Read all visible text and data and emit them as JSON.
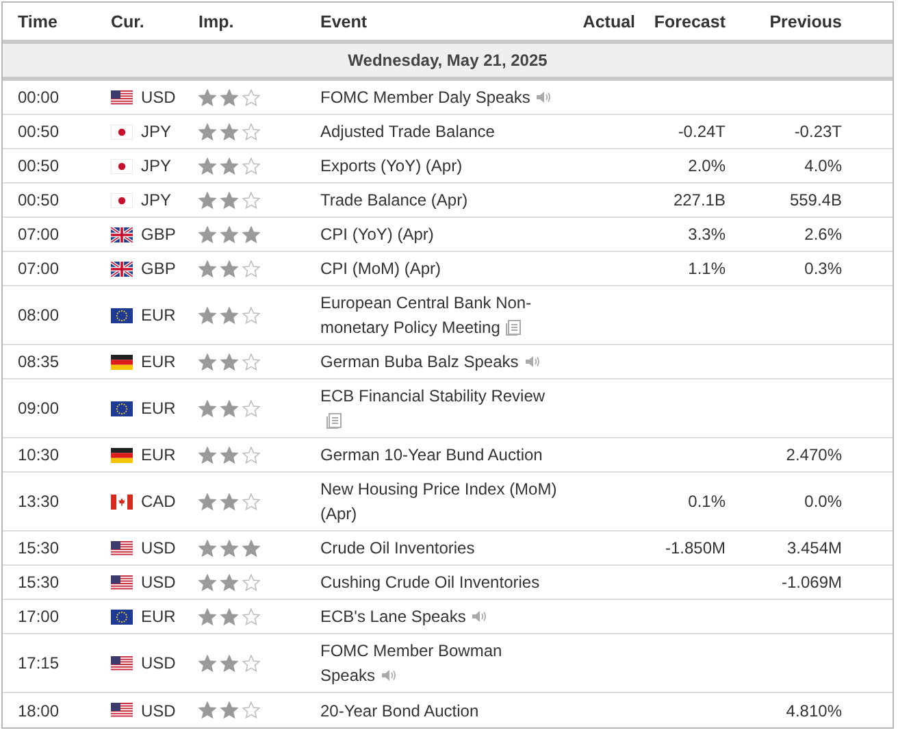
{
  "columns": [
    "Time",
    "Cur.",
    "Imp.",
    "Event",
    "Actual",
    "Forecast",
    "Previous"
  ],
  "date_header": "Wednesday, May 21, 2025",
  "rows": [
    {
      "time": "00:00",
      "flag": {
        "kind": "us"
      },
      "currency": "USD",
      "stars": 2,
      "event": "FOMC Member Daly Speaks",
      "event_icon": {
        "kind": "speaker"
      }
    },
    {
      "time": "00:50",
      "flag": {
        "kind": "jp"
      },
      "currency": "JPY",
      "stars": 2,
      "event": "Adjusted Trade Balance",
      "forecast": "-0.24T",
      "previous": "-0.23T"
    },
    {
      "time": "00:50",
      "flag": {
        "kind": "jp"
      },
      "currency": "JPY",
      "stars": 2,
      "event": "Exports (YoY) (Apr)",
      "forecast": "2.0%",
      "previous": "4.0%"
    },
    {
      "time": "00:50",
      "flag": {
        "kind": "jp"
      },
      "currency": "JPY",
      "stars": 2,
      "event": "Trade Balance (Apr)",
      "forecast": "227.1B",
      "previous": "559.4B"
    },
    {
      "time": "07:00",
      "flag": {
        "kind": "gb"
      },
      "currency": "GBP",
      "stars": 3,
      "event": "CPI (YoY) (Apr)",
      "forecast": "3.3%",
      "previous": "2.6%"
    },
    {
      "time": "07:00",
      "flag": {
        "kind": "gb"
      },
      "currency": "GBP",
      "stars": 2,
      "event": "CPI (MoM) (Apr)",
      "forecast": "1.1%",
      "previous": "0.3%"
    },
    {
      "time": "08:00",
      "flag": {
        "kind": "eu"
      },
      "currency": "EUR",
      "stars": 2,
      "event": "European Central Bank Non-monetary Policy Meeting",
      "event_icon": {
        "kind": "document"
      }
    },
    {
      "time": "08:35",
      "flag": {
        "kind": "de"
      },
      "currency": "EUR",
      "stars": 2,
      "event": "German Buba Balz Speaks",
      "event_icon": {
        "kind": "speaker"
      }
    },
    {
      "time": "09:00",
      "flag": {
        "kind": "eu"
      },
      "currency": "EUR",
      "stars": 2,
      "event": "ECB Financial Stability Review",
      "event_icon": {
        "kind": "document"
      }
    },
    {
      "time": "10:30",
      "flag": {
        "kind": "de"
      },
      "currency": "EUR",
      "stars": 2,
      "event": "German 10-Year Bund Auction",
      "previous": "2.470%"
    },
    {
      "time": "13:30",
      "flag": {
        "kind": "ca"
      },
      "currency": "CAD",
      "stars": 2,
      "event": "New Housing Price Index (MoM) (Apr)",
      "forecast": "0.1%",
      "previous": "0.0%"
    },
    {
      "time": "15:30",
      "flag": {
        "kind": "us"
      },
      "currency": "USD",
      "stars": 3,
      "event": "Crude Oil Inventories",
      "forecast": "-1.850M",
      "previous": "3.454M"
    },
    {
      "time": "15:30",
      "flag": {
        "kind": "us"
      },
      "currency": "USD",
      "stars": 2,
      "event": "Cushing Crude Oil Inventories",
      "previous": "-1.069M"
    },
    {
      "time": "17:00",
      "flag": {
        "kind": "eu"
      },
      "currency": "EUR",
      "stars": 2,
      "event": "ECB's Lane Speaks",
      "event_icon": {
        "kind": "speaker"
      }
    },
    {
      "time": "17:15",
      "flag": {
        "kind": "us"
      },
      "currency": "USD",
      "stars": 2,
      "event": "FOMC Member Bowman Speaks",
      "event_icon": {
        "kind": "speaker"
      }
    },
    {
      "time": "18:00",
      "flag": {
        "kind": "us"
      },
      "currency": "USD",
      "stars": 2,
      "event": "20-Year Bond Auction",
      "previous": "4.810%"
    }
  ]
}
